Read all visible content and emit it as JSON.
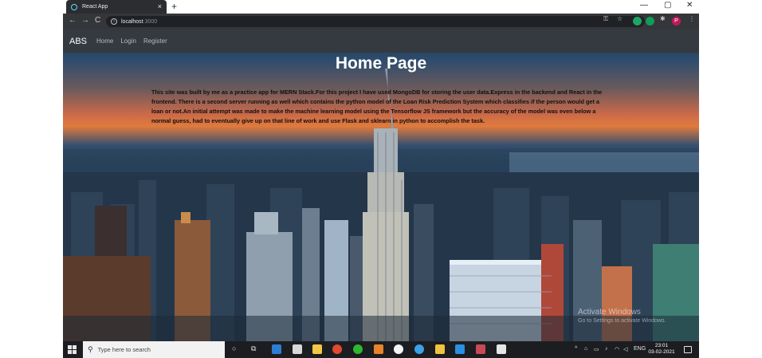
{
  "browser": {
    "tab_title": "React App",
    "tab_close": "×",
    "new_tab": "+",
    "minimize": "—",
    "maximize": "▢",
    "close": "✕",
    "back": "←",
    "forward": "→",
    "reload": "C",
    "url_host": "localhost",
    "url_port": ":3000",
    "key_glyph": "⚿",
    "star_glyph": "☆",
    "puzzle_glyph": "✱",
    "profile_initial": "P",
    "menu_glyph": "⋮"
  },
  "navbar": {
    "brand": "ABS",
    "links": [
      "Home",
      "Login",
      "Register"
    ]
  },
  "main": {
    "title": "Home Page",
    "description": "This site was built by me as a practice app for MERN Stack.For this project I have used MongoDB for storing the user data.Express in the backend and React in the frontend. There is a second server running as well which contains the python model of the Loan Risk Prediction System which classifies if the person would get a loan or not.An initial attempt was made to make the machine learning model using the Tensorflow JS framework but the accuracy of the model was even below a normal guess, had to eventually give up on that line of work and use Flask and sklearn in python to accomplish the task."
  },
  "watermark": {
    "line1": "Activate Windows",
    "line2": "Go to Settings to activate Windows."
  },
  "taskbar": {
    "search_placeholder": "Type here to search",
    "search_glyph": "⚲",
    "cortana_glyph": "○",
    "taskview_glyph": "⧉",
    "tray_chevron": "^",
    "language": "ENG",
    "time": "23:01",
    "date": "03-02-2021"
  },
  "colors": {
    "navbar_bg": "#343a40",
    "chrome_toolbar": "#35363a",
    "taskbar_bg": "#1c1d21"
  }
}
